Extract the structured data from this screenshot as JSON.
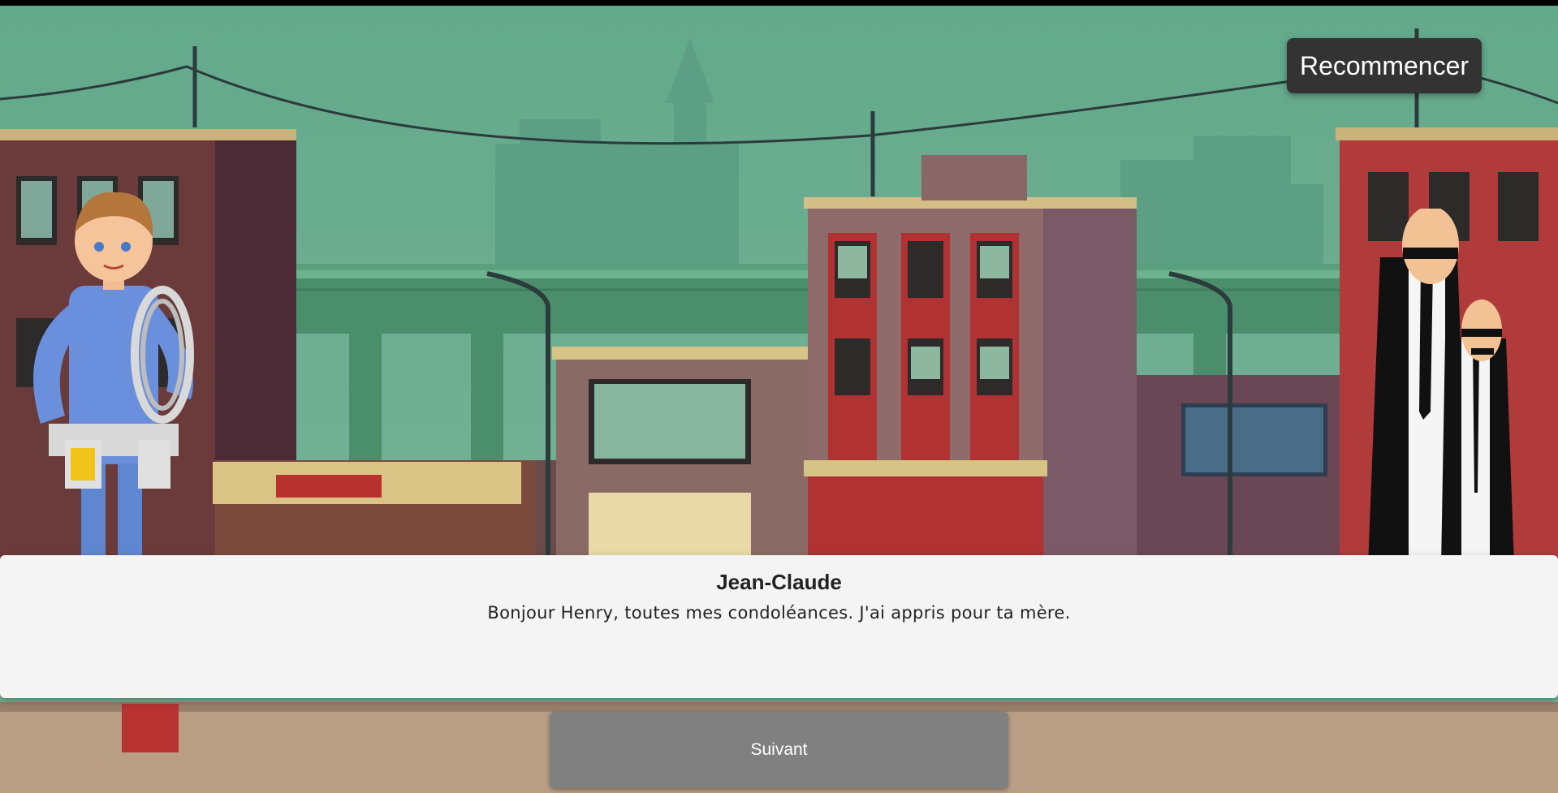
{
  "controls": {
    "restart_label": "Recommencer",
    "next_label": "Suivant"
  },
  "dialogue": {
    "speaker": "Jean-Claude",
    "text": "Bonjour Henry, toutes mes condoléances. J'ai appris pour ta mère."
  },
  "characters": [
    {
      "id": "jean-claude",
      "description": "electrician in blue overalls holding cable coil"
    },
    {
      "id": "henry-and-companion",
      "description": "two bald men in black suits"
    }
  ],
  "colors": {
    "dialog_bg": "#f4f4f4",
    "restart_bg": "#333333",
    "next_bg": "#808080",
    "sky": "#63a98c"
  }
}
